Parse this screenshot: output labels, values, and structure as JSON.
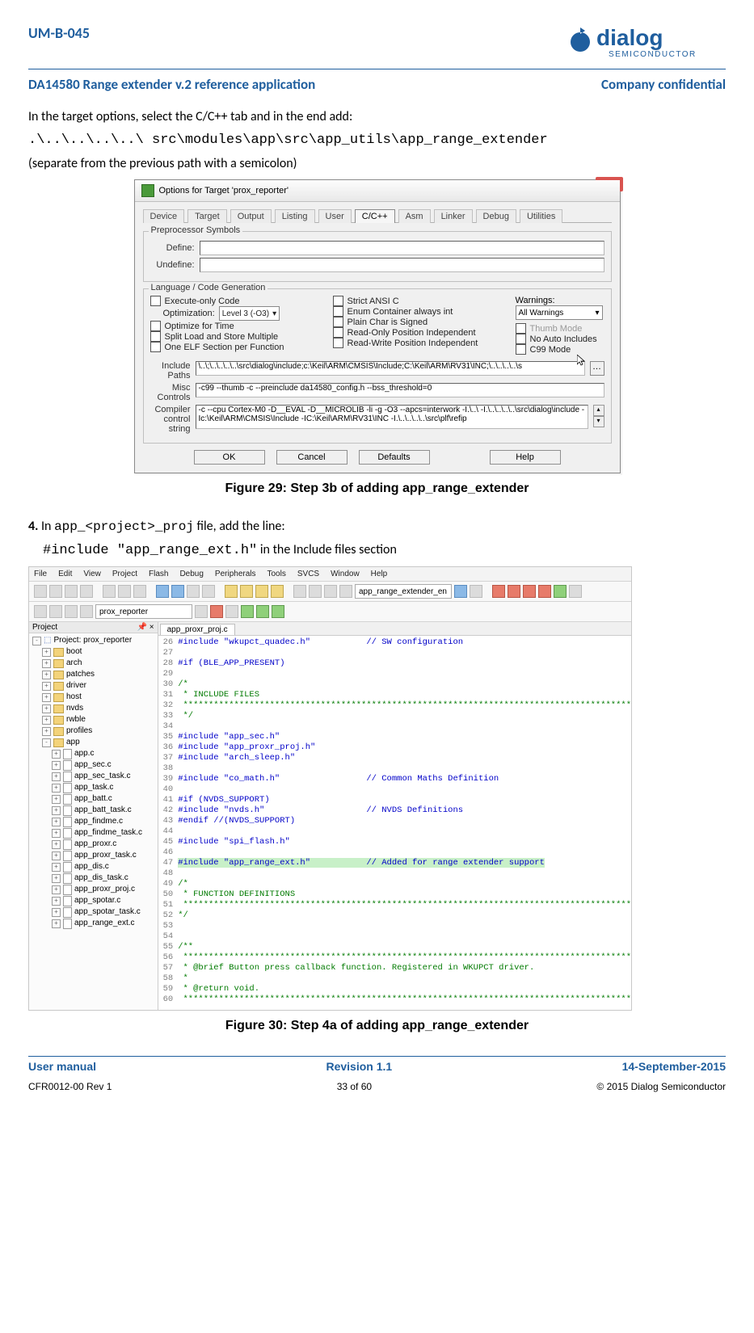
{
  "header": {
    "docnum": "UM-B-045",
    "logo_brand": "dialog",
    "logo_sub": "SEMICONDUCTOR",
    "title": "DA14580 Range extender v.2 reference application",
    "confidential": "Company confidential"
  },
  "intro": {
    "line1": "In the target options, select the C/C++ tab and in the end add:",
    "path": ".\\..\\..\\..\\..\\ src\\modules\\app\\src\\app_utils\\app_range_extender",
    "line2": "(separate from the previous path with a semicolon)"
  },
  "keil": {
    "title": "Options for Target 'prox_reporter'",
    "close": "×",
    "tabs": [
      "Device",
      "Target",
      "Output",
      "Listing",
      "User",
      "C/C++",
      "Asm",
      "Linker",
      "Debug",
      "Utilities"
    ],
    "active_tab": 5,
    "grp_preproc": "Preprocessor Symbols",
    "define_lbl": "Define:",
    "undefine_lbl": "Undefine:",
    "grp_lang": "Language / Code Generation",
    "opt_lbl": "Optimization:",
    "opt_val": "Level 3 (-O3)",
    "left_checks": [
      "Execute-only Code",
      "Optimize for Time",
      "Split Load and Store Multiple",
      "One ELF Section per Function"
    ],
    "mid_checks": [
      "Strict ANSI C",
      "Enum Container always int",
      "Plain Char is Signed",
      "Read-Only Position Independent",
      "Read-Write Position Independent"
    ],
    "warn_lbl": "Warnings:",
    "warn_val": "All Warnings",
    "right_checks": [
      "Thumb Mode",
      "No Auto Includes",
      "C99 Mode"
    ],
    "inc_lbl": "Include\nPaths",
    "inc_val": "\\..\\;\\..\\..\\..\\..\\src\\dialog\\include;c:\\Keil\\ARM\\CMSIS\\Include;C:\\Keil\\ARM\\RV31\\INC;\\..\\..\\..\\..\\s",
    "misc_lbl": "Misc\nControls",
    "misc_val": "-c99 --thumb -c --preinclude da14580_config.h --bss_threshold=0",
    "cc_lbl": "Compiler\ncontrol\nstring",
    "cc_val": "-c --cpu Cortex-M0 -D__EVAL -D__MICROLIB -li -g -O3 --apcs=interwork -I.\\..\\ -I.\\..\\..\\..\\..\\src\\dialog\\include -Ic:\\Keil\\ARM\\CMSIS\\Include -IC:\\Keil\\ARM\\RV31\\INC -I.\\..\\..\\..\\..\\src\\plf\\refip",
    "btns": [
      "OK",
      "Cancel",
      "Defaults",
      "Help"
    ]
  },
  "caption1": "Figure 29: Step 3b of adding app_range_extender",
  "step4": {
    "num": "4.",
    "pre": " In ",
    "file": "app_<project>_proj",
    "post": " file, add the line:",
    "include": "#include \"app_range_ext.h\"",
    "trail": " in the Include files section"
  },
  "ide": {
    "menus": [
      "File",
      "Edit",
      "View",
      "Project",
      "Flash",
      "Debug",
      "Peripherals",
      "Tools",
      "SVCS",
      "Window",
      "Help"
    ],
    "target_combo": "prox_reporter",
    "open_combo": "app_range_extender_en",
    "proj_title": "Project",
    "tab_file": "app_proxr_proj.c",
    "tree_root": "Project: prox_reporter",
    "folders": [
      "boot",
      "arch",
      "patches",
      "driver",
      "host",
      "nvds",
      "rwble",
      "profiles",
      "app"
    ],
    "files": [
      "app.c",
      "app_sec.c",
      "app_sec_task.c",
      "app_task.c",
      "app_batt.c",
      "app_batt_task.c",
      "app_findme.c",
      "app_findme_task.c",
      "app_proxr.c",
      "app_proxr_task.c",
      "app_dis.c",
      "app_dis_task.c",
      "app_proxr_proj.c",
      "app_spotar.c",
      "app_spotar_task.c",
      "app_range_ext.c"
    ],
    "line_start": 26,
    "code": [
      {
        "t": "#include \"wkupct_quadec.h\"           // SW configuration",
        "cls": "c-pp"
      },
      {
        "t": ""
      },
      {
        "t": "#if (BLE_APP_PRESENT)",
        "cls": "c-pp"
      },
      {
        "t": ""
      },
      {
        "t": "/*",
        "cls": "c-cm"
      },
      {
        "t": " * INCLUDE FILES",
        "cls": "c-cm"
      },
      {
        "t": " ****************************************************************************************",
        "cls": "c-bar"
      },
      {
        "t": " */",
        "cls": "c-cm"
      },
      {
        "t": ""
      },
      {
        "t": "#include \"app_sec.h\"",
        "cls": "c-pp"
      },
      {
        "t": "#include \"app_proxr_proj.h\"",
        "cls": "c-pp"
      },
      {
        "t": "#include \"arch_sleep.h\"",
        "cls": "c-pp"
      },
      {
        "t": ""
      },
      {
        "t": "#include \"co_math.h\"                 // Common Maths Definition",
        "cls": "c-pp"
      },
      {
        "t": ""
      },
      {
        "t": "#if (NVDS_SUPPORT)",
        "cls": "c-pp"
      },
      {
        "t": "#include \"nvds.h\"                    // NVDS Definitions",
        "cls": "c-pp"
      },
      {
        "t": "#endif //(NVDS_SUPPORT)",
        "cls": "c-pp"
      },
      {
        "t": ""
      },
      {
        "t": "#include \"spi_flash.h\"",
        "cls": "c-pp"
      },
      {
        "t": ""
      },
      {
        "t": "#include \"app_range_ext.h\"           // Added for range extender support",
        "cls": "c-pp",
        "hi": true
      },
      {
        "t": ""
      },
      {
        "t": "/*",
        "cls": "c-cm"
      },
      {
        "t": " * FUNCTION DEFINITIONS",
        "cls": "c-cm"
      },
      {
        "t": " ****************************************************************************************",
        "cls": "c-bar"
      },
      {
        "t": "*/",
        "cls": "c-cm"
      },
      {
        "t": ""
      },
      {
        "t": ""
      },
      {
        "t": "/**",
        "cls": "c-cm"
      },
      {
        "t": " ****************************************************************************************",
        "cls": "c-bar"
      },
      {
        "t": " * @brief Button press callback function. Registered in WKUPCT driver.",
        "cls": "c-cm"
      },
      {
        "t": " *",
        "cls": "c-cm"
      },
      {
        "t": " * @return void.",
        "cls": "c-cm"
      },
      {
        "t": " ****************************************************************************************",
        "cls": "c-bar"
      }
    ]
  },
  "caption2": "Figure 30: Step 4a of adding app_range_extender",
  "footer": {
    "l1_left": "User manual",
    "l1_mid": "Revision 1.1",
    "l1_right": "14-September-2015",
    "l2_left": "CFR0012-00 Rev 1",
    "l2_mid": "33 of 60",
    "l2_right": "© 2015 Dialog Semiconductor"
  }
}
